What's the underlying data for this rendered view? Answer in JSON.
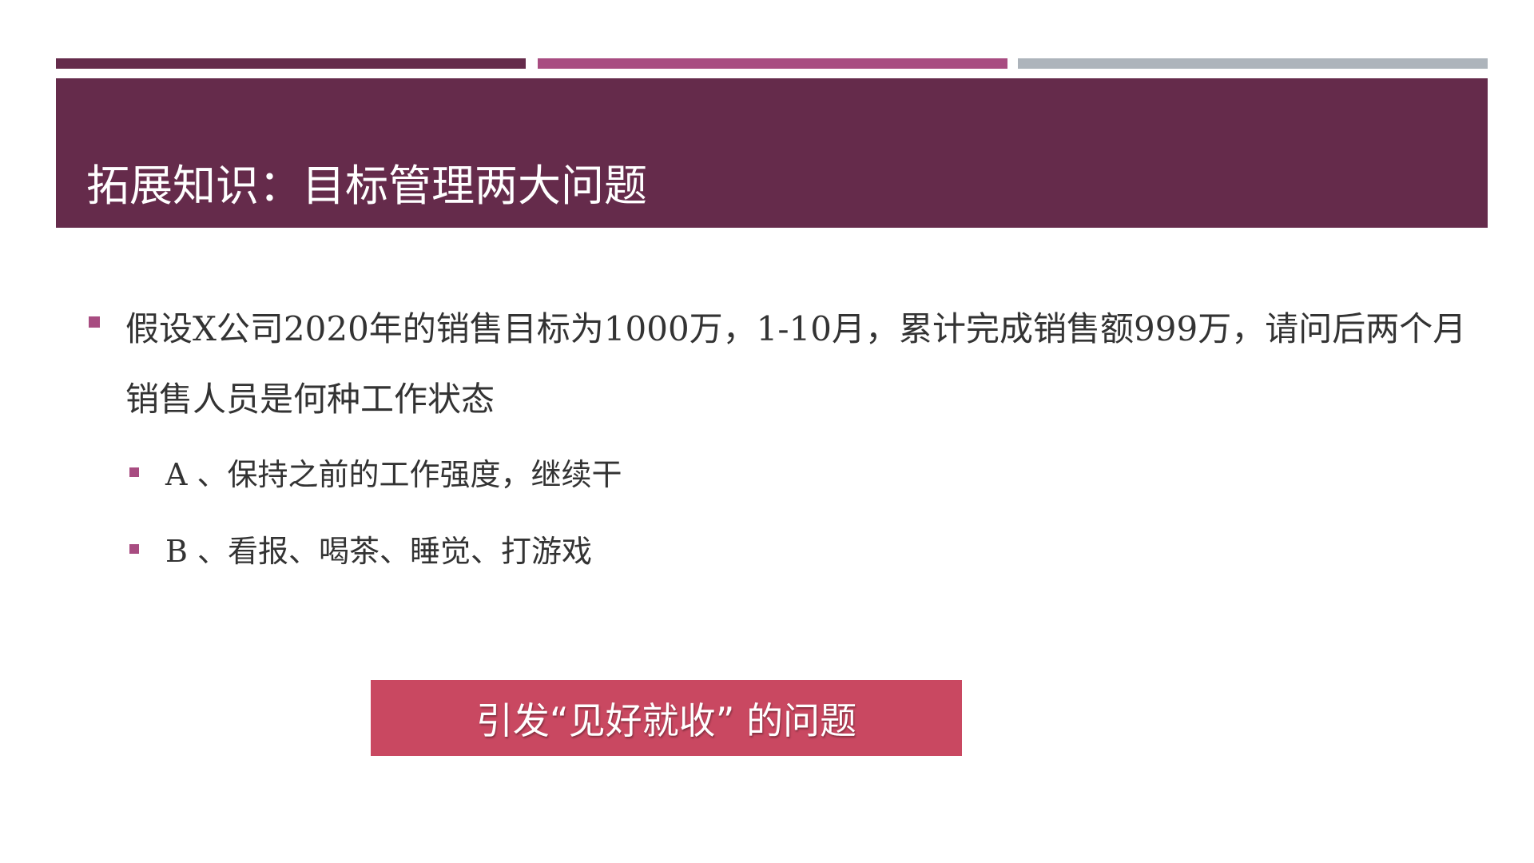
{
  "slide": {
    "title": "拓展知识：目标管理两大问题",
    "main_bullet": "假设X公司2020年的销售目标为1000万，1-10月，累计完成销售额999万，请问后两个月销售人员是何种工作状态",
    "options": [
      {
        "label": "A 、保持之前的工作强度，继续干"
      },
      {
        "label": "B 、看报、喝茶、睡觉、打游戏"
      }
    ],
    "callout": "引发“见好就收” 的问题"
  },
  "colors": {
    "primary": "#652b4b",
    "accent": "#a84c81",
    "gray_bar": "#adb4bb",
    "callout": "#c94861",
    "text": "#333333"
  }
}
